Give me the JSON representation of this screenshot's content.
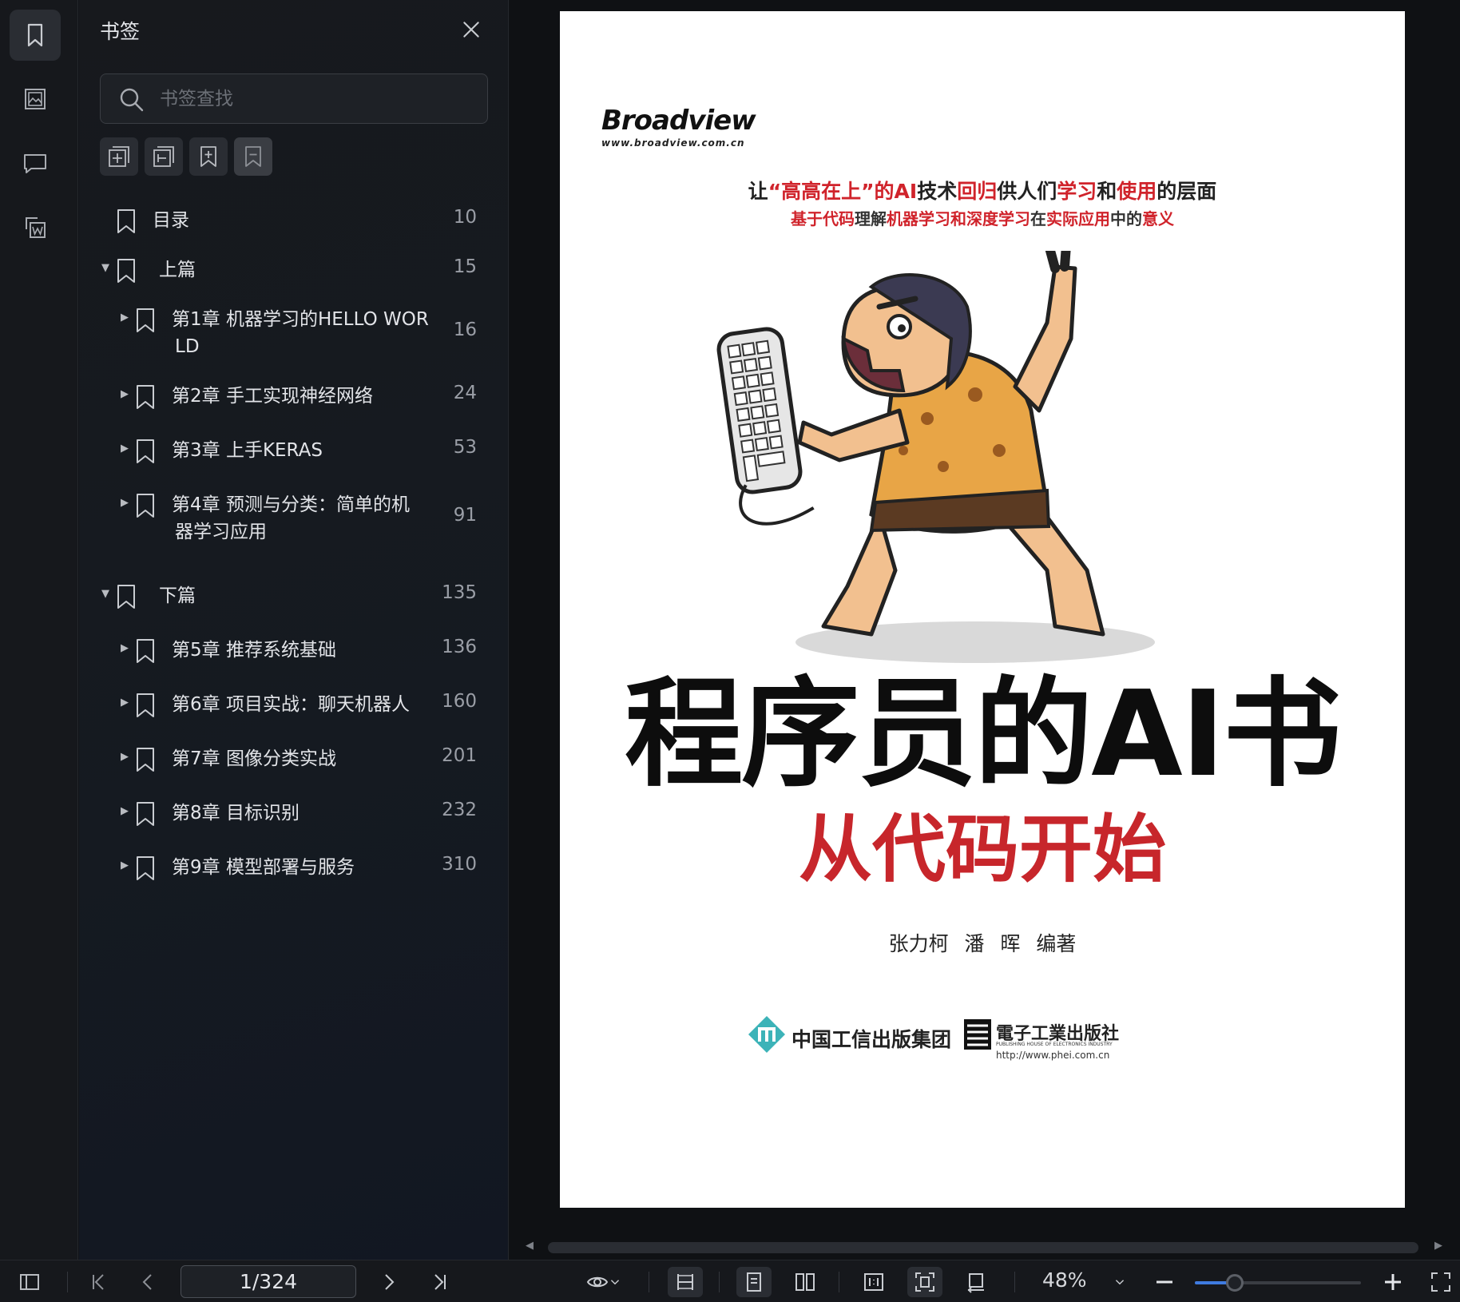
{
  "sidebar_rail": {
    "items": [
      {
        "icon": "bookmark-icon",
        "active": true
      },
      {
        "icon": "image-icon",
        "active": false
      },
      {
        "icon": "comment-icon",
        "active": false
      },
      {
        "icon": "word-export-icon",
        "active": false
      }
    ]
  },
  "bookmark_panel": {
    "title": "书签",
    "search_placeholder": "书签查找",
    "items": [
      {
        "label": "目录",
        "page": "10",
        "level": 0,
        "arrow": ""
      },
      {
        "label": "上篇",
        "page": "15",
        "level": 0,
        "arrow": "▼"
      },
      {
        "label": "第1章  机器学习的HELLO WOR",
        "label2": "LD",
        "page": "16",
        "level": 1,
        "arrow": "▶"
      },
      {
        "label": "第2章  手工实现神经网络",
        "page": "24",
        "level": 1,
        "arrow": "▶"
      },
      {
        "label": "第3章  上手KERAS",
        "page": "53",
        "level": 1,
        "arrow": "▶"
      },
      {
        "label": "第4章  预测与分类：简单的机",
        "label2": "器学习应用",
        "page": "91",
        "level": 1,
        "arrow": "▶"
      },
      {
        "label": "下篇",
        "page": "135",
        "level": 0,
        "arrow": "▼"
      },
      {
        "label": "第5章  推荐系统基础",
        "page": "136",
        "level": 1,
        "arrow": "▶"
      },
      {
        "label": "第6章  项目实战：聊天机器人",
        "page": "160",
        "level": 1,
        "arrow": "▶"
      },
      {
        "label": "第7章  图像分类实战",
        "page": "201",
        "level": 1,
        "arrow": "▶"
      },
      {
        "label": "第8章  目标识别",
        "page": "232",
        "level": 1,
        "arrow": "▶"
      },
      {
        "label": "第9章  模型部署与服务",
        "page": "310",
        "level": 1,
        "arrow": "▶"
      }
    ]
  },
  "cover": {
    "brand": "Broadview",
    "brand_url": "www.broadview.com.cn",
    "tagline1_parts": [
      "让",
      "“高高在上”的AI",
      "技术",
      "回归",
      "供人们",
      "学习",
      "和",
      "使用",
      "的层面"
    ],
    "tagline2_parts": [
      "基于代码",
      "理解",
      "机器学习和深度学习",
      "在",
      "实际应用",
      "中的",
      "意义"
    ],
    "title": "程序员的AI书",
    "subtitle": "从代码开始",
    "authors": "张力柯  潘  晖  编著",
    "publisher_group": "中国工信出版集团",
    "publisher_house": "電子工業出版社",
    "publisher_house_en": "PUBLISHING HOUSE OF ELECTRONICS INDUSTRY",
    "publisher_url": "http://www.phei.com.cn"
  },
  "toolbar": {
    "page_indicator": "1/324",
    "zoom_label": "48%",
    "zoom_fraction": 0.24
  }
}
